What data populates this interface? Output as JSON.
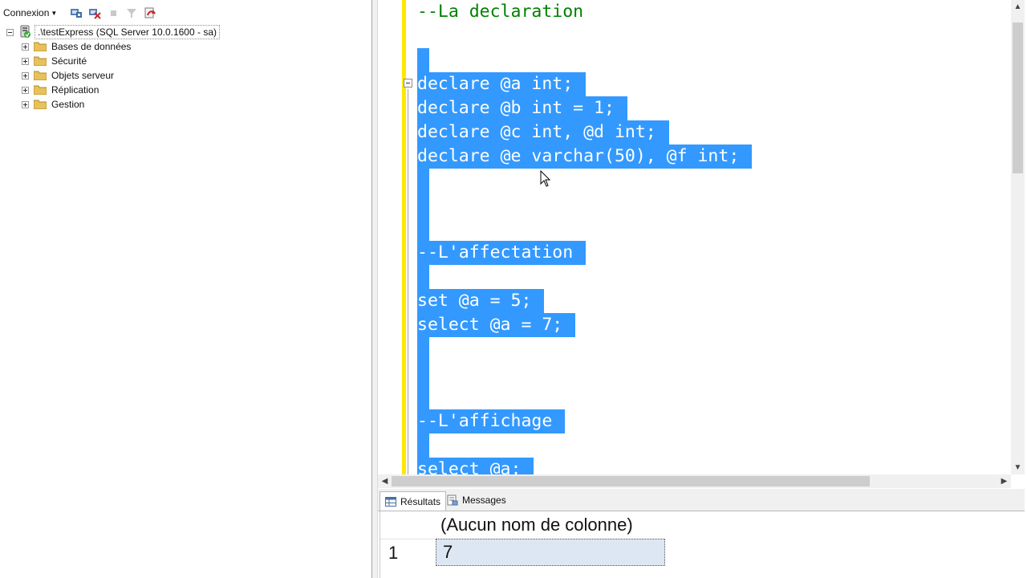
{
  "object_explorer": {
    "toolbar": {
      "connect_label": "Connexion",
      "icons": [
        "connect-icon",
        "disconnect-icon",
        "stop-icon",
        "filter-icon",
        "refresh-icon"
      ]
    },
    "server": {
      "label": ".\\testExpress (SQL Server 10.0.1600 - sa)",
      "expanded": true
    },
    "nodes": [
      {
        "label": "Bases de données"
      },
      {
        "label": "Sécurité"
      },
      {
        "label": "Objets serveur"
      },
      {
        "label": "Réplication"
      },
      {
        "label": "Gestion"
      }
    ]
  },
  "editor": {
    "colors": {
      "selection": "#3399ff",
      "comment": "#008000",
      "change_bar": "#ffe800"
    },
    "lines": [
      "--La declaration",
      "declare @a int;",
      "declare @b int = 1;",
      "declare @c int, @d int;",
      "declare @e varchar(50), @f int;",
      "--L'affectation",
      "set @a = 5;",
      "select @a = 7;",
      "--L'affichage",
      "select @a;"
    ]
  },
  "results": {
    "tabs": [
      {
        "label": "Résultats",
        "active": true
      },
      {
        "label": "Messages",
        "active": false
      }
    ],
    "column_header": "(Aucun nom de colonne)",
    "rows": [
      {
        "num": "1",
        "value": "7"
      }
    ]
  }
}
